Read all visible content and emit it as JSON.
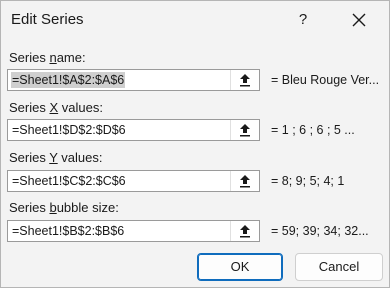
{
  "dialog": {
    "title": "Edit Series",
    "help_label": "?",
    "close_icon": "close-icon"
  },
  "fields": [
    {
      "label_pre": "Series ",
      "label_ul": "n",
      "label_post": "ame:",
      "value": "=Sheet1!$A$2:$A$6",
      "preview": "= Bleu Rouge Ver...",
      "selected": true
    },
    {
      "label_pre": "Series ",
      "label_ul": "X",
      "label_post": " values:",
      "value": "=Sheet1!$D$2:$D$6",
      "preview": "= 1 ; 6 ; 6 ; 5 ...",
      "selected": false
    },
    {
      "label_pre": "Series ",
      "label_ul": "Y",
      "label_post": " values:",
      "value": "=Sheet1!$C$2:$C$6",
      "preview": "= 8; 9; 5; 4; 1",
      "selected": false
    },
    {
      "label_pre": "Series ",
      "label_ul": "b",
      "label_post": "ubble size:",
      "value": "=Sheet1!$B$2:$B$6",
      "preview": "= 59; 39; 34; 32...",
      "selected": false
    }
  ],
  "buttons": {
    "ok_label": "OK",
    "cancel_label": "Cancel"
  },
  "colors": {
    "accent": "#0f6cbd"
  }
}
